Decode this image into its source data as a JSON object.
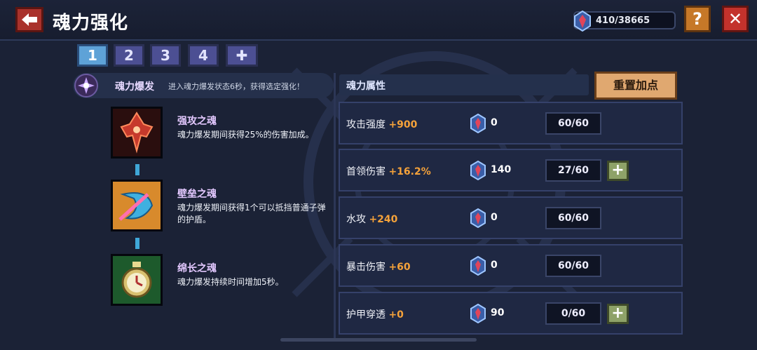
{
  "header": {
    "title": "魂力强化",
    "currency": "410/38665",
    "help_label": "?",
    "close_label": "✕"
  },
  "tabs": [
    {
      "label": "1",
      "active": true
    },
    {
      "label": "2",
      "active": false
    },
    {
      "label": "3",
      "active": false
    },
    {
      "label": "4",
      "active": false
    },
    {
      "label": "✚",
      "active": false
    }
  ],
  "burst": {
    "title": "魂力爆发",
    "description": "进入魂力爆发状态6秒，获得选定强化！"
  },
  "souls": [
    {
      "name": "强攻之魂",
      "description": "魂力爆发期间获得25%的伤害加成。"
    },
    {
      "name": "壁垒之魂",
      "description": "魂力爆发期间获得1个可以抵挡普通子弹的护盾。"
    },
    {
      "name": "绵长之魂",
      "description": "魂力爆发持续时间增加5秒。"
    }
  ],
  "attributes": {
    "title": "魂力属性",
    "reset_label": "重置加点",
    "rows": [
      {
        "label": "攻击强度",
        "bonus": "+900",
        "cost": "0",
        "level": "60/60",
        "can_add": false
      },
      {
        "label": "首领伤害",
        "bonus": "+16.2%",
        "cost": "140",
        "level": "27/60",
        "can_add": true
      },
      {
        "label": "水攻",
        "bonus": "+240",
        "cost": "0",
        "level": "60/60",
        "can_add": false
      },
      {
        "label": "暴击伤害",
        "bonus": "+60",
        "cost": "0",
        "level": "60/60",
        "can_add": false
      },
      {
        "label": "护甲穿透",
        "bonus": "+0",
        "cost": "90",
        "level": "0/60",
        "can_add": true
      }
    ]
  },
  "colors": {
    "accent_orange": "#f5a23a",
    "tab_active": "#5ea2d7",
    "tab_inactive": "#4c4f93",
    "close_red": "#c3322c"
  }
}
